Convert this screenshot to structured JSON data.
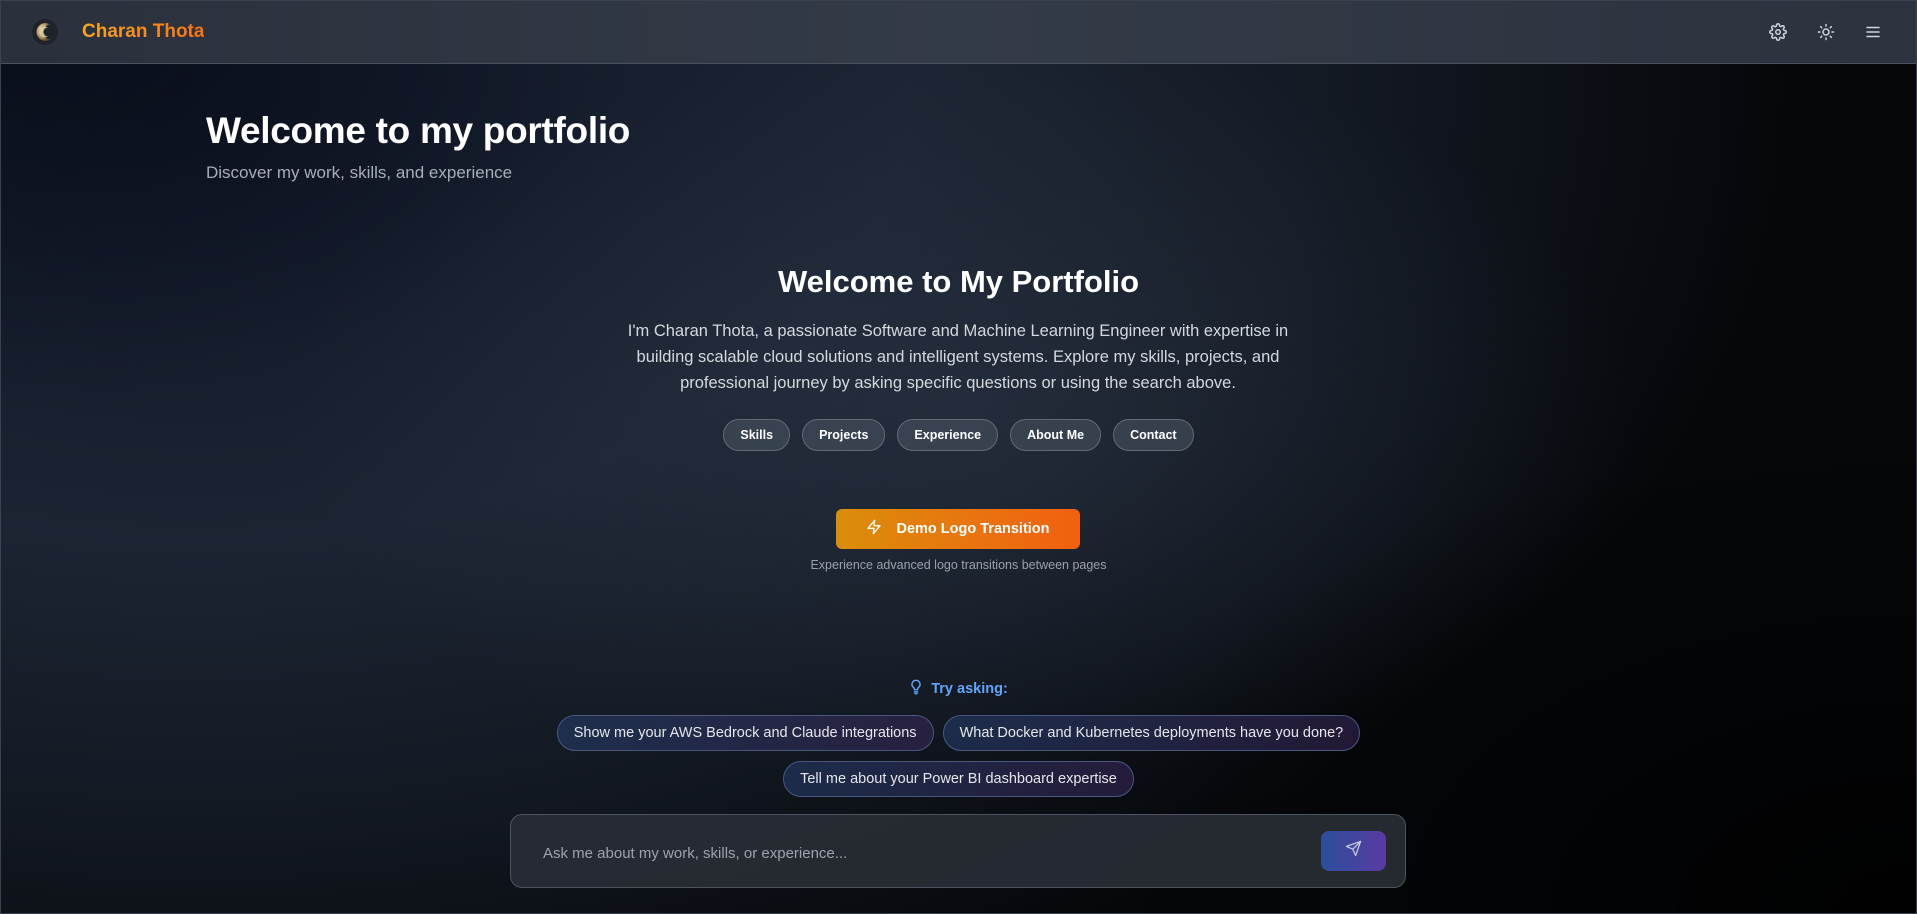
{
  "header": {
    "brand": "Charan Thota",
    "logo_icon": "crescent-logo-icon",
    "actions": [
      {
        "icon": "gear-icon",
        "label": "Settings"
      },
      {
        "icon": "sun-icon",
        "label": "Toggle theme"
      },
      {
        "icon": "menu-icon",
        "label": "Menu"
      }
    ]
  },
  "page": {
    "title": "Welcome to my portfolio",
    "subtitle": "Discover my work, skills, and experience"
  },
  "hero": {
    "title": "Welcome to My Portfolio",
    "description": "I'm Charan Thota, a passionate Software and Machine Learning Engineer with expertise in building scalable cloud solutions and intelligent systems. Explore my skills, projects, and professional journey by asking specific questions or using the search above.",
    "chips": [
      "Skills",
      "Projects",
      "Experience",
      "About Me",
      "Contact"
    ],
    "demo_button": "Demo Logo Transition",
    "demo_icon": "lightning-icon",
    "demo_caption": "Experience advanced logo transitions between pages"
  },
  "suggestions": {
    "heading": "Try asking:",
    "heading_icon": "lightbulb-icon",
    "row1": [
      "Show me your AWS Bedrock and Claude integrations",
      "What Docker and Kubernetes deployments have you done?"
    ],
    "row2": [
      "Tell me about your Power BI dashboard expertise"
    ]
  },
  "chat": {
    "placeholder": "Ask me about my work, skills, or experience...",
    "value": "",
    "send_icon": "send-icon"
  },
  "colors": {
    "brand_accent": "#f59e0b",
    "demo_button_start": "#d98e0a",
    "demo_button_end": "#f0600f",
    "try_asking": "#60a5fa",
    "send_button_start": "#2b4f9a",
    "send_button_end": "#5b3aa3"
  }
}
